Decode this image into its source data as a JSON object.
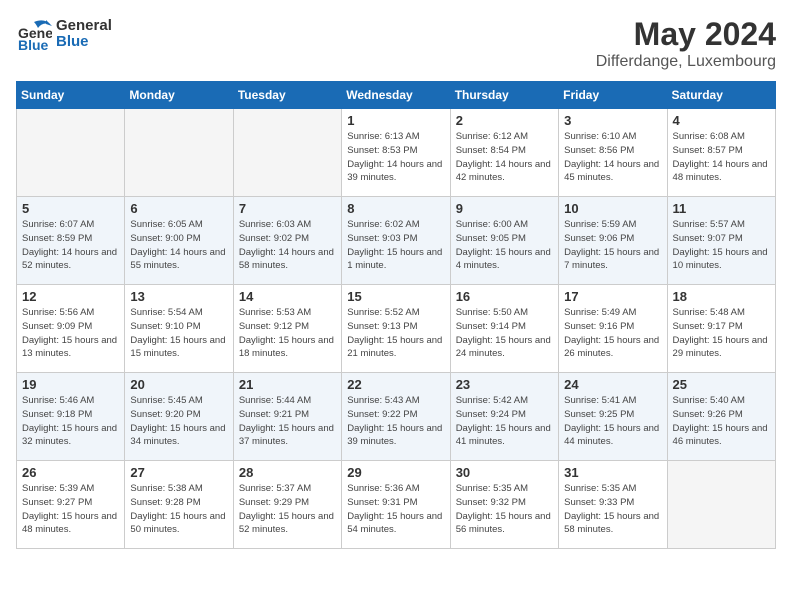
{
  "header": {
    "logo_line1": "General",
    "logo_line2": "Blue",
    "month": "May 2024",
    "location": "Differdange, Luxembourg"
  },
  "weekdays": [
    "Sunday",
    "Monday",
    "Tuesday",
    "Wednesday",
    "Thursday",
    "Friday",
    "Saturday"
  ],
  "weeks": [
    [
      {
        "day": "",
        "empty": true
      },
      {
        "day": "",
        "empty": true
      },
      {
        "day": "",
        "empty": true
      },
      {
        "day": "1",
        "sunrise": "6:13 AM",
        "sunset": "8:53 PM",
        "daylight": "14 hours and 39 minutes."
      },
      {
        "day": "2",
        "sunrise": "6:12 AM",
        "sunset": "8:54 PM",
        "daylight": "14 hours and 42 minutes."
      },
      {
        "day": "3",
        "sunrise": "6:10 AM",
        "sunset": "8:56 PM",
        "daylight": "14 hours and 45 minutes."
      },
      {
        "day": "4",
        "sunrise": "6:08 AM",
        "sunset": "8:57 PM",
        "daylight": "14 hours and 48 minutes."
      }
    ],
    [
      {
        "day": "5",
        "sunrise": "6:07 AM",
        "sunset": "8:59 PM",
        "daylight": "14 hours and 52 minutes."
      },
      {
        "day": "6",
        "sunrise": "6:05 AM",
        "sunset": "9:00 PM",
        "daylight": "14 hours and 55 minutes."
      },
      {
        "day": "7",
        "sunrise": "6:03 AM",
        "sunset": "9:02 PM",
        "daylight": "14 hours and 58 minutes."
      },
      {
        "day": "8",
        "sunrise": "6:02 AM",
        "sunset": "9:03 PM",
        "daylight": "15 hours and 1 minute."
      },
      {
        "day": "9",
        "sunrise": "6:00 AM",
        "sunset": "9:05 PM",
        "daylight": "15 hours and 4 minutes."
      },
      {
        "day": "10",
        "sunrise": "5:59 AM",
        "sunset": "9:06 PM",
        "daylight": "15 hours and 7 minutes."
      },
      {
        "day": "11",
        "sunrise": "5:57 AM",
        "sunset": "9:07 PM",
        "daylight": "15 hours and 10 minutes."
      }
    ],
    [
      {
        "day": "12",
        "sunrise": "5:56 AM",
        "sunset": "9:09 PM",
        "daylight": "15 hours and 13 minutes."
      },
      {
        "day": "13",
        "sunrise": "5:54 AM",
        "sunset": "9:10 PM",
        "daylight": "15 hours and 15 minutes."
      },
      {
        "day": "14",
        "sunrise": "5:53 AM",
        "sunset": "9:12 PM",
        "daylight": "15 hours and 18 minutes."
      },
      {
        "day": "15",
        "sunrise": "5:52 AM",
        "sunset": "9:13 PM",
        "daylight": "15 hours and 21 minutes."
      },
      {
        "day": "16",
        "sunrise": "5:50 AM",
        "sunset": "9:14 PM",
        "daylight": "15 hours and 24 minutes."
      },
      {
        "day": "17",
        "sunrise": "5:49 AM",
        "sunset": "9:16 PM",
        "daylight": "15 hours and 26 minutes."
      },
      {
        "day": "18",
        "sunrise": "5:48 AM",
        "sunset": "9:17 PM",
        "daylight": "15 hours and 29 minutes."
      }
    ],
    [
      {
        "day": "19",
        "sunrise": "5:46 AM",
        "sunset": "9:18 PM",
        "daylight": "15 hours and 32 minutes."
      },
      {
        "day": "20",
        "sunrise": "5:45 AM",
        "sunset": "9:20 PM",
        "daylight": "15 hours and 34 minutes."
      },
      {
        "day": "21",
        "sunrise": "5:44 AM",
        "sunset": "9:21 PM",
        "daylight": "15 hours and 37 minutes."
      },
      {
        "day": "22",
        "sunrise": "5:43 AM",
        "sunset": "9:22 PM",
        "daylight": "15 hours and 39 minutes."
      },
      {
        "day": "23",
        "sunrise": "5:42 AM",
        "sunset": "9:24 PM",
        "daylight": "15 hours and 41 minutes."
      },
      {
        "day": "24",
        "sunrise": "5:41 AM",
        "sunset": "9:25 PM",
        "daylight": "15 hours and 44 minutes."
      },
      {
        "day": "25",
        "sunrise": "5:40 AM",
        "sunset": "9:26 PM",
        "daylight": "15 hours and 46 minutes."
      }
    ],
    [
      {
        "day": "26",
        "sunrise": "5:39 AM",
        "sunset": "9:27 PM",
        "daylight": "15 hours and 48 minutes."
      },
      {
        "day": "27",
        "sunrise": "5:38 AM",
        "sunset": "9:28 PM",
        "daylight": "15 hours and 50 minutes."
      },
      {
        "day": "28",
        "sunrise": "5:37 AM",
        "sunset": "9:29 PM",
        "daylight": "15 hours and 52 minutes."
      },
      {
        "day": "29",
        "sunrise": "5:36 AM",
        "sunset": "9:31 PM",
        "daylight": "15 hours and 54 minutes."
      },
      {
        "day": "30",
        "sunrise": "5:35 AM",
        "sunset": "9:32 PM",
        "daylight": "15 hours and 56 minutes."
      },
      {
        "day": "31",
        "sunrise": "5:35 AM",
        "sunset": "9:33 PM",
        "daylight": "15 hours and 58 minutes."
      },
      {
        "day": "",
        "empty": true
      }
    ]
  ]
}
